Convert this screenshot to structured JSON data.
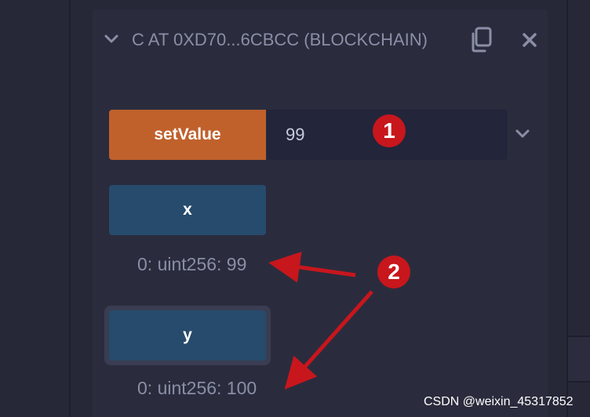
{
  "instance": {
    "title": "C AT 0XD70...6CBCC (BLOCKCHAIN)"
  },
  "functions": {
    "set_value": {
      "label": "setValue",
      "input_value": "99"
    },
    "x": {
      "label": "x",
      "result": "0: uint256: 99"
    },
    "y": {
      "label": "y",
      "result": "0: uint256: 100"
    }
  },
  "annotations": {
    "badge_1": "1",
    "badge_2": "2"
  },
  "watermark": "CSDN @weixin_45317852",
  "colors": {
    "background": "#262838",
    "panel": "#2a2c3d",
    "transact_button": "#c0612c",
    "call_button": "#274b6c",
    "annotation_red": "#c8161d",
    "muted_text": "#8a8ea6"
  },
  "icons": {
    "collapse": "chevron-down-icon",
    "copy": "copy-icon",
    "close": "close-icon",
    "expand_inputs": "chevron-down-icon"
  }
}
